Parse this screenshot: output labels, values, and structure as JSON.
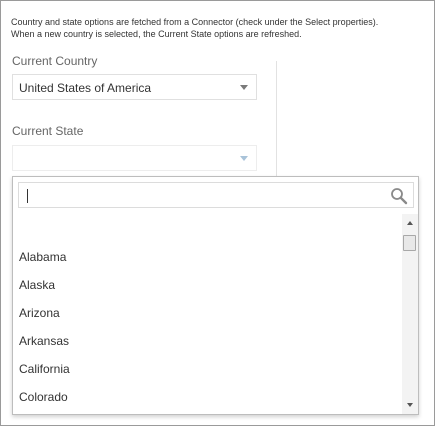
{
  "description": {
    "line1": "Country and state options are fetched from a Connector (check under the Select properties).",
    "line2": "When a new country is selected, the Current State options are refreshed."
  },
  "country": {
    "label": "Current Country",
    "value": "United States of America"
  },
  "state": {
    "label": "Current State",
    "value": ""
  },
  "dropdown": {
    "search_value": "",
    "options": [
      "Alabama",
      "Alaska",
      "Arizona",
      "Arkansas",
      "California",
      "Colorado"
    ]
  },
  "icons": {
    "search": "search-icon",
    "caret": "chevron-down-icon"
  }
}
